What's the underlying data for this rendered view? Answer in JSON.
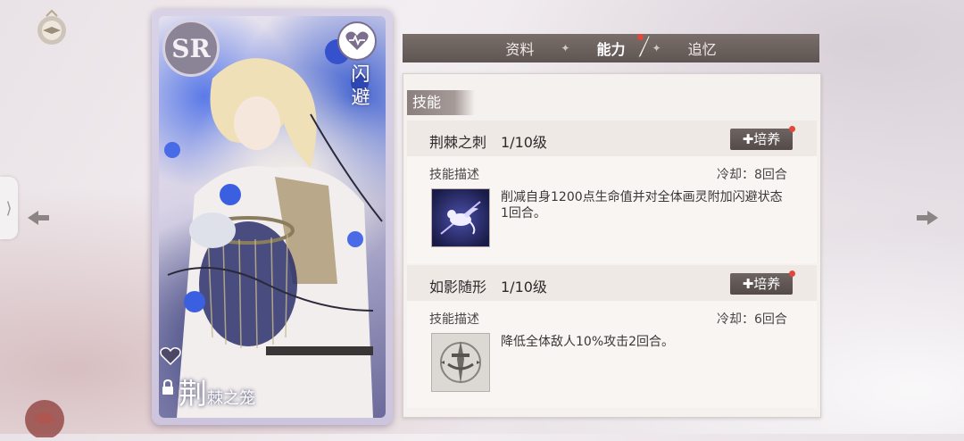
{
  "card": {
    "rarity": "SR",
    "attribute_label": "闪避",
    "name_big": "荆",
    "name_rest": "棘之笼"
  },
  "tabs": [
    {
      "label": "资料"
    },
    {
      "label": "能力"
    },
    {
      "label": "追忆"
    }
  ],
  "tab_separator": "✦",
  "panel": {
    "title": "技能",
    "skills": [
      {
        "name": "荆棘之刺",
        "level": "1/10级",
        "train_label": "培养",
        "desc_label": "技能描述",
        "cooldown": "冷却：8回合",
        "description": "削减自身1200点生命值并对全体画灵附加闪避状态1回合。",
        "icon": "winged-cat-icon"
      },
      {
        "name": "如影随形",
        "level": "1/10级",
        "train_label": "培养",
        "desc_label": "技能描述",
        "cooldown": "冷却：6回合",
        "description": "降低全体敌人10%攻击2回合。",
        "icon": "dagger-emblem-icon"
      }
    ]
  },
  "colors": {
    "tab_bar": "#5e5552",
    "notification_dot": "#e2473a",
    "panel_bg": "#f5f1ef"
  }
}
